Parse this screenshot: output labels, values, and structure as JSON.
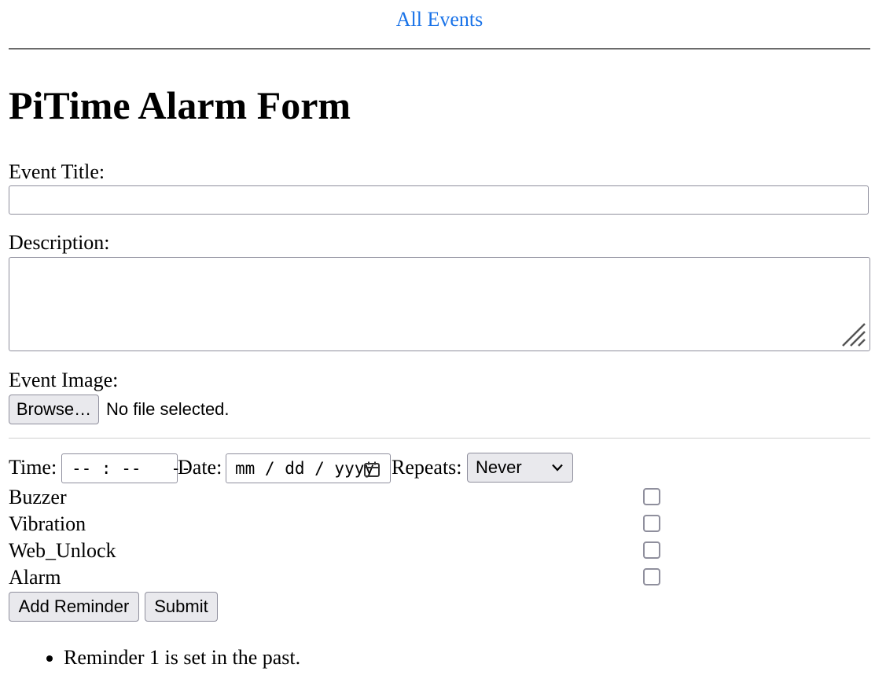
{
  "nav": {
    "all_events_link": "All Events"
  },
  "page_title": "PiTime Alarm Form",
  "form": {
    "event_title_label": "Event Title:",
    "event_title_value": "",
    "description_label": "Description:",
    "description_value": "",
    "event_image_label": "Event Image:",
    "browse_button": "Browse…",
    "file_status": "No file selected.",
    "time_label": "Time:",
    "time_placeholder": "-- : --   --",
    "date_label": "Date:",
    "date_placeholder": "mm / dd / yyyy",
    "repeats_label": "Repeats:",
    "repeats_selected": "Never",
    "options": [
      {
        "label": "Buzzer",
        "checked": false
      },
      {
        "label": "Vibration",
        "checked": false
      },
      {
        "label": "Web_Unlock",
        "checked": false
      },
      {
        "label": "Alarm",
        "checked": false
      }
    ],
    "add_reminder_button": "Add Reminder",
    "submit_button": "Submit"
  },
  "reminders": [
    "Reminder 1 is set in the past."
  ],
  "colors": {
    "link": "#1a73e8",
    "button_bg": "#e9e9ed",
    "border": "#8f8f9d"
  },
  "icons": {
    "date_picker": "calendar-icon",
    "select_arrow": "chevron-down-icon",
    "textarea_resize": "resize-grip-icon"
  }
}
